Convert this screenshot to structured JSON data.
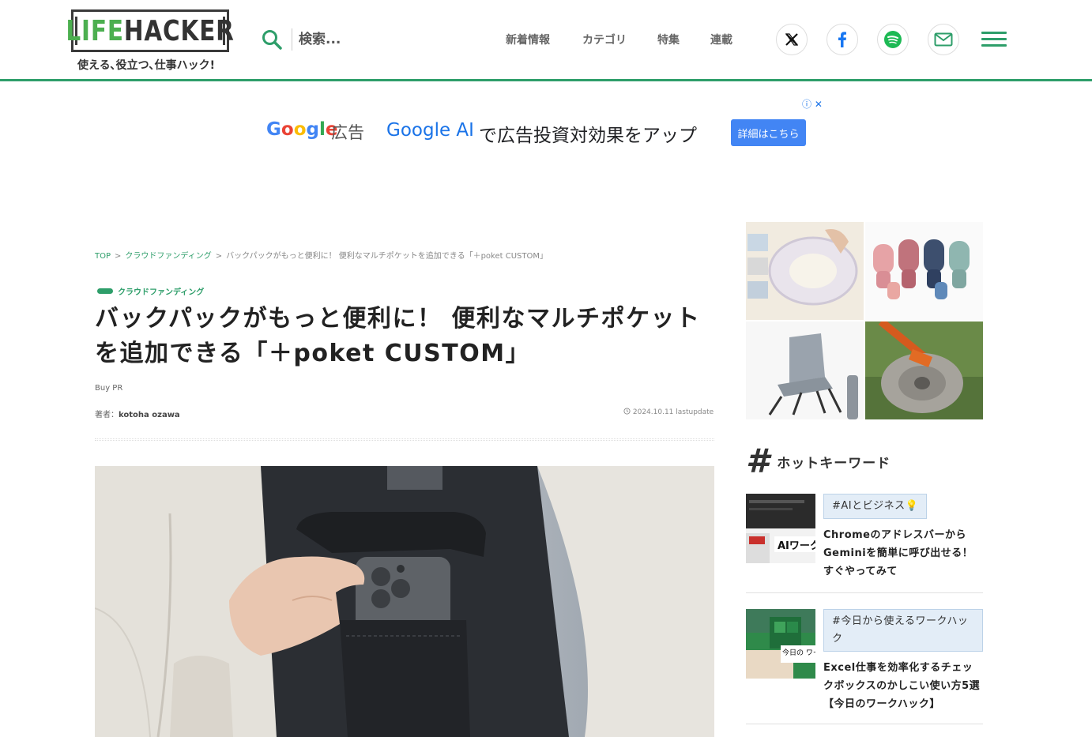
{
  "header": {
    "logo_life": "LIFE",
    "logo_hacker": "HACKER",
    "tagline": "使える､役立つ､仕事ハック!",
    "search_placeholder": "検索...",
    "nav": [
      "新着情報",
      "カテゴリ",
      "特集",
      "連載"
    ],
    "social_icons": [
      "x-icon",
      "facebook-icon",
      "spotify-icon",
      "mail-icon"
    ],
    "accent_color": "#2e9e6a"
  },
  "ad": {
    "google_logo": "Google",
    "label": "広告",
    "brand": "Google AI",
    "text": "で広告投資対効果をアップ",
    "button": "詳細はこちら",
    "info": "ⓘ ✕"
  },
  "article": {
    "breadcrumb": {
      "top": "TOP",
      "category": "クラウドファンディング",
      "current": "バックパックがもっと便利に！ 便利なマルチポケットを追加できる「＋poket CUSTOM」"
    },
    "category_tag": "クラウドファンディング",
    "title": "バックパックがもっと便利に！ 便利なマルチポケットを追加できる「＋poket CUSTOM」",
    "buy_pr": "Buy PR",
    "author_label": "著者：",
    "author_name": "kotoha ozawa",
    "date": "2024.10.11 lastupdate"
  },
  "sidebar": {
    "hot_title": "ホットキーワード",
    "keywords": [
      {
        "tag": "#AIとビジネス💡",
        "text": "Chromeのアドレスバーから Geminiを簡単に呼び出せる！ すぐやってみて",
        "thumb_label": "AIワーク"
      },
      {
        "tag": "#今日から使えるワークハック",
        "text": "Excel仕事を効率化するチェックボックスのかしこい使い方5選【今日のワークハック】",
        "thumb_label": "今日の ワークハック"
      }
    ]
  }
}
